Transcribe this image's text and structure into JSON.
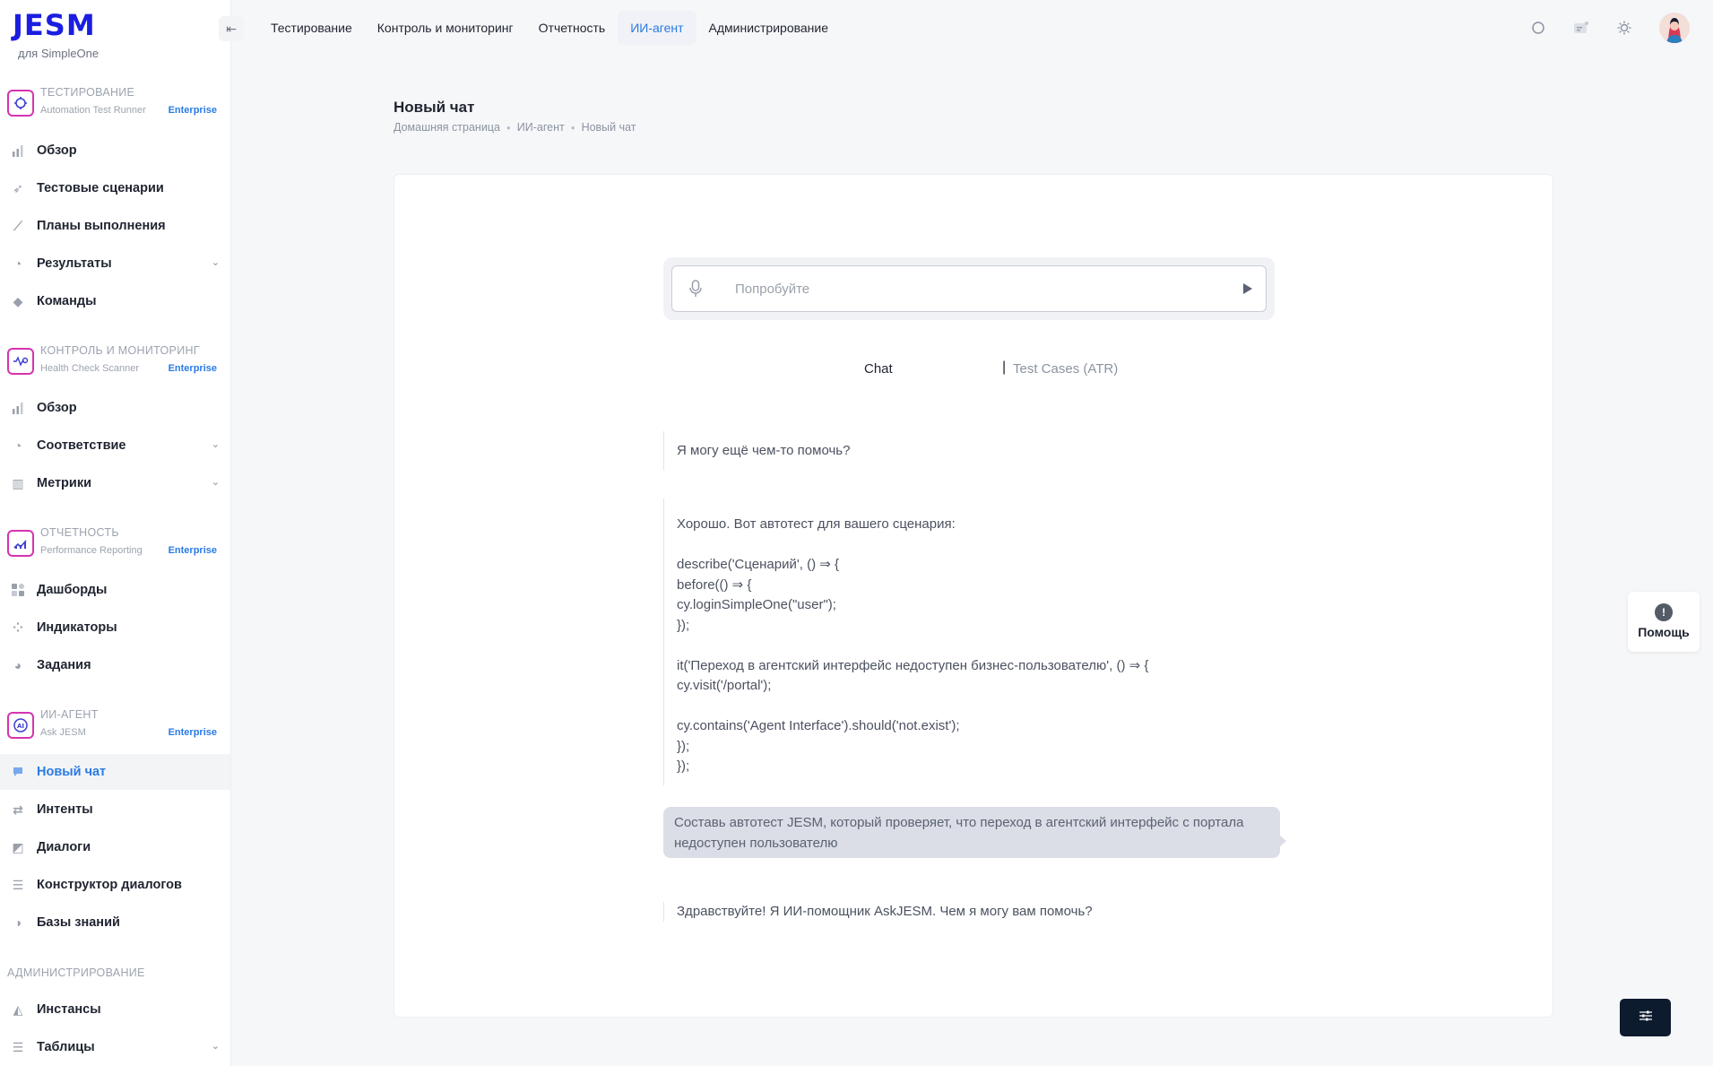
{
  "brand": {
    "logo": "JESM",
    "subtitle": "для SimpleOne"
  },
  "sidebar": {
    "sections": [
      {
        "title": "ТЕСТИРОВАНИЕ",
        "subtitle": "Automation Test Runner",
        "badge": "Enterprise",
        "items": [
          {
            "label": "Обзор",
            "icon": "chart-bars-icon"
          },
          {
            "label": "Тестовые сценарии",
            "icon": "rocket-icon"
          },
          {
            "label": "Планы выполнения",
            "icon": "brush-icon"
          },
          {
            "label": "Результаты",
            "icon": "results-icon",
            "expandable": true
          },
          {
            "label": "Команды",
            "icon": "layers-icon"
          }
        ]
      },
      {
        "title": "КОНТРОЛЬ И МОНИТОРИНГ",
        "subtitle": "Health Check Scanner",
        "badge": "Enterprise",
        "items": [
          {
            "label": "Обзор",
            "icon": "chart-bars-icon"
          },
          {
            "label": "Соответствие",
            "icon": "compliance-icon",
            "expandable": true
          },
          {
            "label": "Метрики",
            "icon": "metrics-icon",
            "expandable": true
          }
        ]
      },
      {
        "title": "ОТЧЕТНОСТЬ",
        "subtitle": "Performance Reporting",
        "badge": "Enterprise",
        "items": [
          {
            "label": "Дашборды",
            "icon": "dashboard-icon"
          },
          {
            "label": "Индикаторы",
            "icon": "indicators-icon"
          },
          {
            "label": "Задания",
            "icon": "tasks-icon"
          }
        ]
      },
      {
        "title": "ИИ-АГЕНТ",
        "subtitle": "Ask JESM",
        "badge": "Enterprise",
        "items": [
          {
            "label": "Новый чат",
            "icon": "chat-icon",
            "active": true
          },
          {
            "label": "Интенты",
            "icon": "arrows-icon"
          },
          {
            "label": "Диалоги",
            "icon": "dialogs-icon"
          },
          {
            "label": "Конструктор диалогов",
            "icon": "list-icon"
          },
          {
            "label": "Базы знаний",
            "icon": "knowledge-icon"
          }
        ]
      }
    ],
    "admin": {
      "title": "АДМИНИСТРИРОВАНИЕ",
      "items": [
        {
          "label": "Инстансы",
          "icon": "instances-icon"
        },
        {
          "label": "Таблицы",
          "icon": "tables-icon",
          "expandable": true
        }
      ]
    }
  },
  "topnav": {
    "items": [
      "Тестирование",
      "Контроль и мониторинг",
      "Отчетность",
      "ИИ-агент",
      "Администрирование"
    ],
    "active": "ИИ-агент"
  },
  "page": {
    "title": "Новый чат",
    "breadcrumb": [
      "Домашняя страница",
      "ИИ-агент",
      "Новый чат"
    ]
  },
  "chat": {
    "input_placeholder": "Попробуйте",
    "input_value": "",
    "tabs": {
      "chat": "Chat",
      "separator": "|",
      "atr": "Test Cases (ATR)"
    },
    "messages": {
      "help_more": "Я могу ещё чем-то помочь?",
      "code_intro": "Хорошо. Вот автотест для вашего сценария:",
      "code_lines": [
        "describe('Сценарий', () ⇒ {",
        "before(() ⇒ {",
        "cy.loginSimpleOne(\"user\");",
        "});",
        "",
        "it('Переход в агентский интерфейс недоступен бизнес-пользователю', () ⇒ {",
        "cy.visit('/portal');",
        "",
        "cy.contains('Agent Interface').should('not.exist');",
        "});",
        "});"
      ],
      "user_request": "Составь автотест JESM, который проверяет, что переход в агентский интерфейс с портала недоступен пользователю",
      "greeting": "Здравствуйте! Я ИИ-помощник AskJESM. Чем я могу вам помочь?"
    }
  },
  "widgets": {
    "help_label": "Помощь"
  },
  "colors": {
    "brand": "#1b1ee0",
    "accent": "#2a7be4",
    "badge": "#2a7be4",
    "fab": "#0d1b2e"
  }
}
